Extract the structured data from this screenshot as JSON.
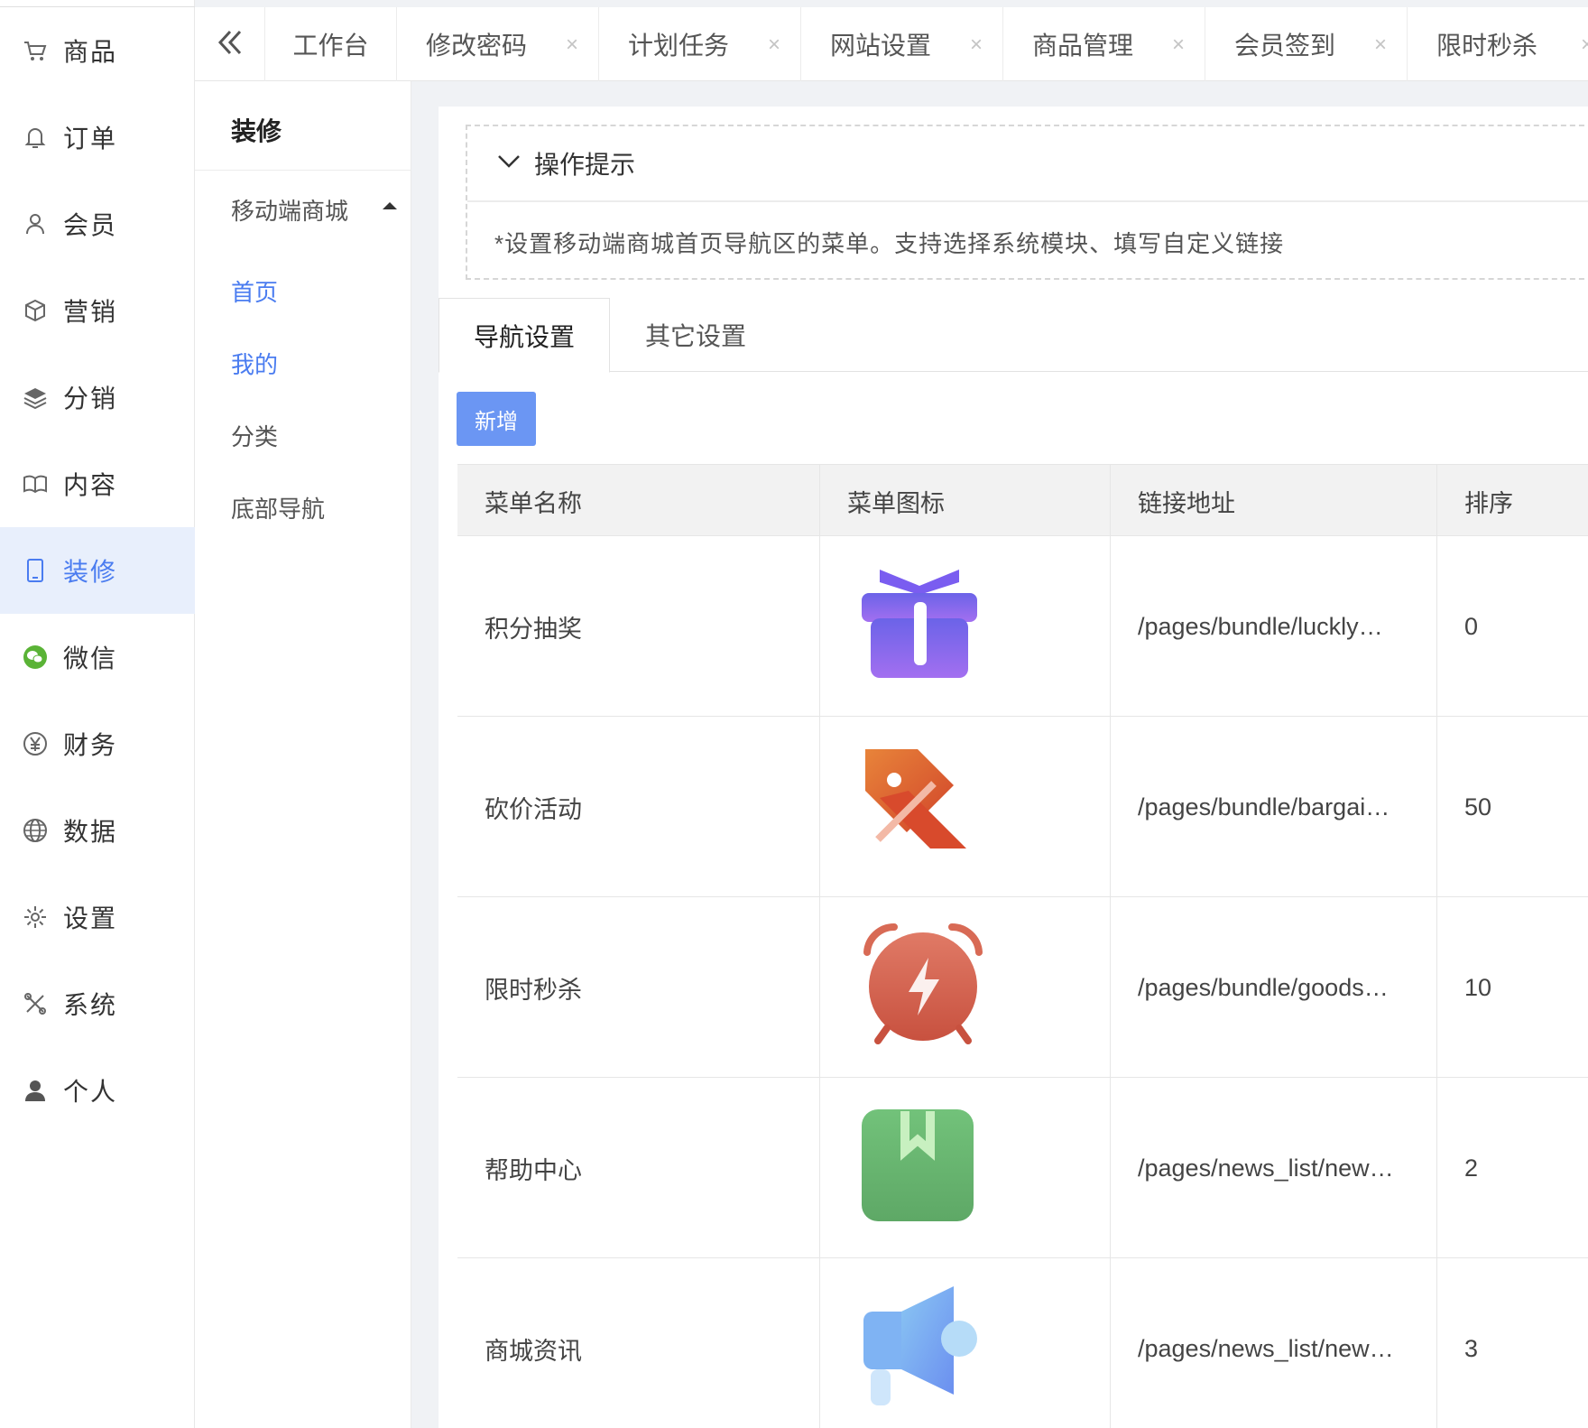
{
  "sidebar": {
    "items": [
      {
        "label": "商品",
        "icon": "cart-icon"
      },
      {
        "label": "订单",
        "icon": "bell-icon"
      },
      {
        "label": "会员",
        "icon": "user-icon"
      },
      {
        "label": "营销",
        "icon": "box-icon"
      },
      {
        "label": "分销",
        "icon": "layers-icon"
      },
      {
        "label": "内容",
        "icon": "book-icon"
      },
      {
        "label": "装修",
        "icon": "tablet-icon",
        "active": true
      },
      {
        "label": "微信",
        "icon": "wechat-icon"
      },
      {
        "label": "财务",
        "icon": "yen-icon"
      },
      {
        "label": "数据",
        "icon": "globe-icon"
      },
      {
        "label": "设置",
        "icon": "gear-icon"
      },
      {
        "label": "系统",
        "icon": "tools-icon"
      },
      {
        "label": "个人",
        "icon": "person-icon"
      }
    ]
  },
  "tabbar": {
    "tabs": [
      {
        "label": "工作台",
        "closable": false
      },
      {
        "label": "修改密码",
        "closable": true
      },
      {
        "label": "计划任务",
        "closable": true
      },
      {
        "label": "网站设置",
        "closable": true
      },
      {
        "label": "商品管理",
        "closable": true
      },
      {
        "label": "会员签到",
        "closable": true
      },
      {
        "label": "限时秒杀",
        "closable": true
      }
    ],
    "close_glyph": "×"
  },
  "subside": {
    "title": "装修",
    "group": "移动端商城",
    "links": [
      {
        "label": "首页",
        "active": true
      },
      {
        "label": "我的",
        "active": true
      },
      {
        "label": "分类",
        "active": false
      },
      {
        "label": "底部导航",
        "active": false
      }
    ]
  },
  "tip": {
    "title": "操作提示",
    "body": "*设置移动端商城首页导航区的菜单。支持选择系统模块、填写自定义链接"
  },
  "tabs": [
    "导航设置",
    "其它设置"
  ],
  "add_label": "新增",
  "table": {
    "headers": [
      "菜单名称",
      "菜单图标",
      "链接地址",
      "排序"
    ],
    "rows": [
      {
        "name": "积分抽奖",
        "icon": "gift-icon",
        "link": "/pages/bundle/luckly…",
        "sort": "0"
      },
      {
        "name": "砍价活动",
        "icon": "price-tag-icon",
        "link": "/pages/bundle/bargai…",
        "sort": "50"
      },
      {
        "name": "限时秒杀",
        "icon": "alarm-clock-icon",
        "link": "/pages/bundle/goods…",
        "sort": "10"
      },
      {
        "name": "帮助中心",
        "icon": "bookmark-book-icon",
        "link": "/pages/news_list/new…",
        "sort": "2"
      },
      {
        "name": "商城资讯",
        "icon": "megaphone-icon",
        "link": "/pages/news_list/new…",
        "sort": "3"
      }
    ]
  }
}
